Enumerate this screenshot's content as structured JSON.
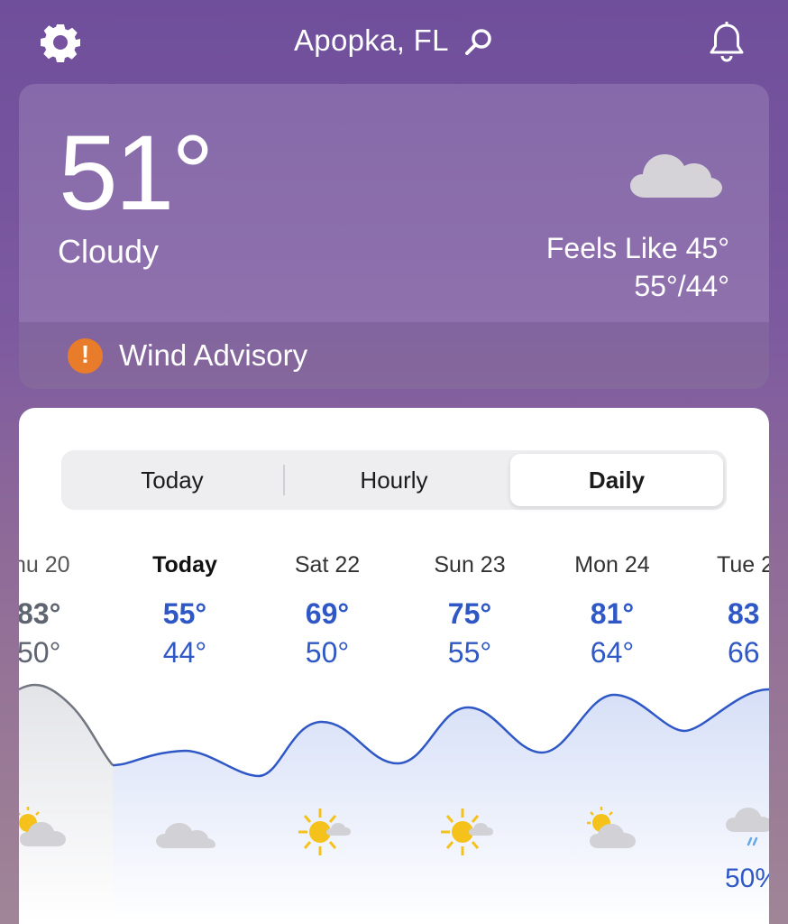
{
  "header": {
    "location": "Apopka, FL",
    "icons": [
      "gear-icon",
      "search-icon",
      "bell-icon"
    ]
  },
  "current": {
    "temperature": "51°",
    "condition": "Cloudy",
    "feels_like": "Feels Like 45°",
    "hi_lo": "55°/44°",
    "icon": "cloud-icon"
  },
  "advisory": {
    "label": "Wind Advisory",
    "icon": "alert-icon",
    "color": "#e97c2a"
  },
  "tabs": {
    "today": "Today",
    "hourly": "Hourly",
    "daily": "Daily",
    "selected": "Daily"
  },
  "days": [
    {
      "name": "hu 20",
      "hi": "83°",
      "lo": "50°",
      "icon": "partly-sunny-icon",
      "past": true
    },
    {
      "name": "Today",
      "hi": "55°",
      "lo": "44°",
      "icon": "cloud-icon"
    },
    {
      "name": "Sat 22",
      "hi": "69°",
      "lo": "50°",
      "icon": "sun-cloud-icon"
    },
    {
      "name": "Sun 23",
      "hi": "75°",
      "lo": "55°",
      "icon": "sun-cloud-icon"
    },
    {
      "name": "Mon 24",
      "hi": "81°",
      "lo": "64°",
      "icon": "partly-sunny-icon"
    },
    {
      "name": "Tue 2",
      "hi": "83",
      "lo": "66",
      "icon": "rain-icon",
      "precip": "50%"
    }
  ],
  "colors": {
    "accent": "#2f58c6",
    "past": "#5e6470"
  }
}
